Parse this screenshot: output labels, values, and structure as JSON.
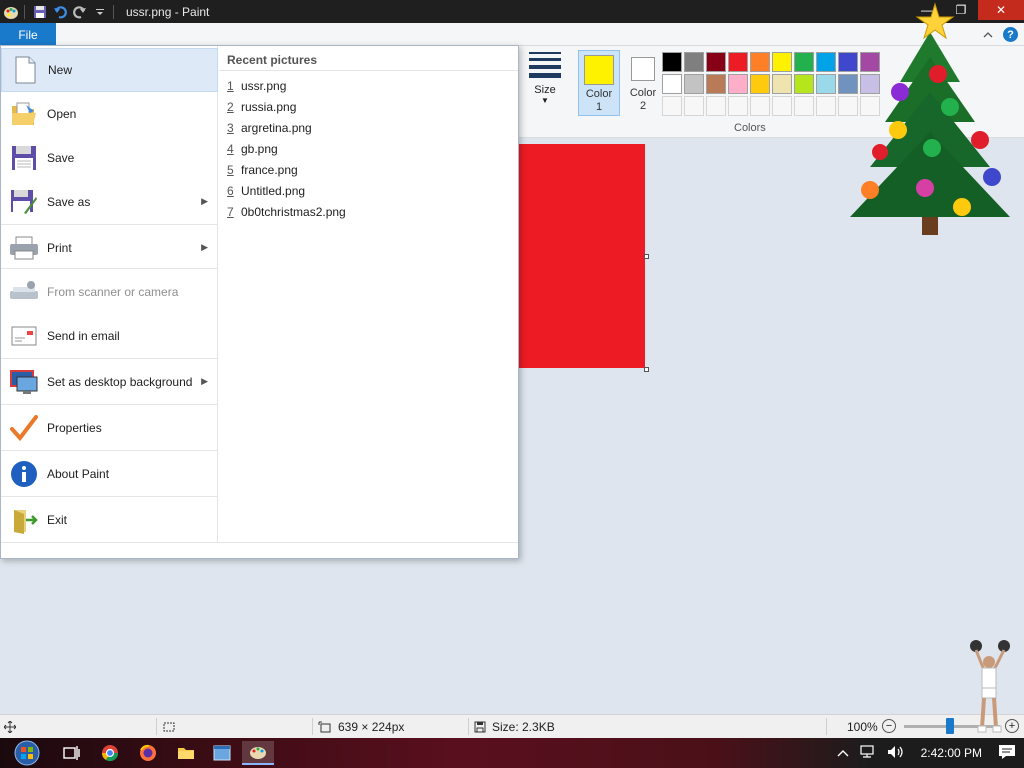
{
  "titlebar": {
    "title": "ussr.png - Paint",
    "minimize_glyph": "—",
    "maximize_glyph": "❐",
    "close_glyph": "✕"
  },
  "tabs": {
    "file_label": "File",
    "help_label": "?"
  },
  "ribbon": {
    "size_label": "Size",
    "color1_label": "Color 1",
    "color2_label": "Color 2",
    "colors_label": "Colors",
    "color1_value": "#fff200",
    "color2_value": "#ffffff",
    "palette_row1": [
      "#000000",
      "#7f7f7f",
      "#880015",
      "#ed1c24",
      "#ff7f27",
      "#fff200",
      "#22b14c",
      "#00a2e8",
      "#3f48cc",
      "#a349a4"
    ],
    "palette_row2": [
      "#ffffff",
      "#c3c3c3",
      "#b97a57",
      "#ffaec9",
      "#ffc90e",
      "#efe4b0",
      "#b5e61d",
      "#99d9ea",
      "#7092be",
      "#c8bfe7"
    ]
  },
  "file_menu": {
    "items": [
      {
        "label": "New",
        "icon": "new-document-icon",
        "hover": true
      },
      {
        "label": "Open",
        "icon": "open-folder-icon"
      },
      {
        "label": "Save",
        "icon": "floppy-disk-icon"
      },
      {
        "label": "Save as",
        "icon": "save-as-icon",
        "submenu": true
      },
      {
        "label": "Print",
        "icon": "printer-icon",
        "submenu": true
      },
      {
        "label": "From scanner or camera",
        "icon": "scanner-icon",
        "disabled": true
      },
      {
        "label": "Send in email",
        "icon": "email-icon"
      },
      {
        "label": "Set as desktop background",
        "icon": "desktop-background-icon",
        "submenu": true
      },
      {
        "label": "Properties",
        "icon": "checkmark-icon"
      },
      {
        "label": "About Paint",
        "icon": "info-icon"
      },
      {
        "label": "Exit",
        "icon": "exit-icon"
      }
    ],
    "recent_title": "Recent pictures",
    "recent": [
      {
        "num": "1",
        "name": "ussr.png"
      },
      {
        "num": "2",
        "name": "russia.png"
      },
      {
        "num": "3",
        "name": "argretina.png"
      },
      {
        "num": "4",
        "name": "gb.png"
      },
      {
        "num": "5",
        "name": "france.png"
      },
      {
        "num": "6",
        "name": "Untitled.png"
      },
      {
        "num": "7",
        "name": "0b0tchristmas2.png"
      }
    ],
    "submenu_arrow": "▶"
  },
  "canvas": {
    "image_color": "#ed1c24"
  },
  "statusbar": {
    "selection_size": "",
    "image_size": "639 × 224px",
    "file_size": "Size: 2.3KB",
    "zoom": "100%",
    "zoom_level": 1.0,
    "zoom_out": "−",
    "zoom_in": "+"
  },
  "taskbar": {
    "time": "2:42:00 PM",
    "tray_up_glyph": "^"
  }
}
